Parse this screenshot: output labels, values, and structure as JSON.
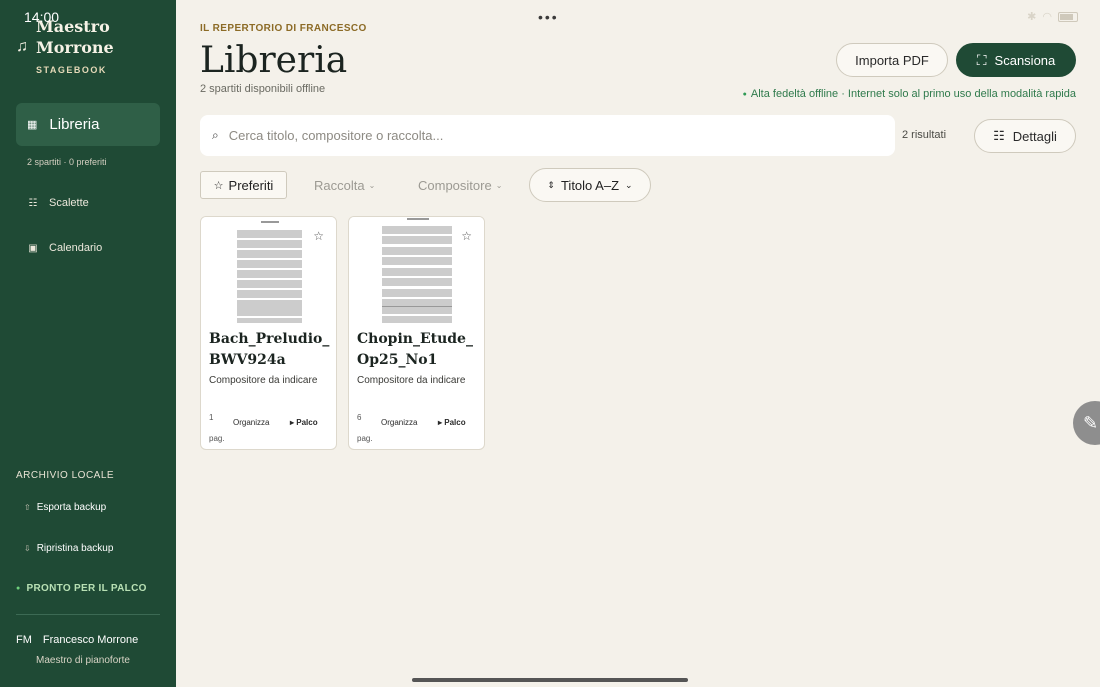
{
  "status": {
    "time": "14:00"
  },
  "sidebar": {
    "brand_line1": "Maestro",
    "brand_line2": "Morrone",
    "brand_sub": "STAGEBOOK",
    "active_item": "Libreria",
    "library_meta": "2 spartiti · 0 preferiti",
    "items": [
      {
        "label": "Scalette",
        "icon": "list-icon"
      },
      {
        "label": "Calendario",
        "icon": "calendar-icon"
      }
    ],
    "archive_heading": "ARCHIVIO LOCALE",
    "export_label": "Esporta backup",
    "restore_label": "Ripristina backup",
    "ready_label": "PRONTO PER IL PALCO",
    "user_initials": "FM",
    "user_name": "Francesco Morrone",
    "user_role": "Maestro di pianoforte"
  },
  "header": {
    "eyebrow": "IL REPERTORIO DI FRANCESCO",
    "title": "Libreria",
    "subtitle": "2 spartiti disponibili offline",
    "import_label": "Importa PDF",
    "scan_label": "Scansiona",
    "fidelity_note": "Alta fedeltà offline · Internet solo al primo uso della modalità rapida"
  },
  "search": {
    "placeholder": "Cerca titolo, compositore o raccolta...",
    "results": "2 risultati",
    "details_label": "Dettagli"
  },
  "filters": {
    "favorites": "Preferiti",
    "collection": "Raccolta",
    "composer": "Compositore",
    "sort": "Titolo A–Z"
  },
  "scores": [
    {
      "title": "Bach_Preludio_BWV924a",
      "composer": "Compositore da indicare",
      "pages": "1 pag.",
      "organize": "Organizza",
      "stage": "▸ Palco"
    },
    {
      "title": "Chopin_Etude_Op25_No1",
      "composer": "Compositore da indicare",
      "pages": "6 pag.",
      "organize": "Organizza",
      "stage": "▸ Palco"
    }
  ],
  "colors": {
    "sidebar": "#1f4a35",
    "accent_gold": "#8c6b26",
    "ready_green": "#6fd17c",
    "background": "#f4f1ea"
  }
}
